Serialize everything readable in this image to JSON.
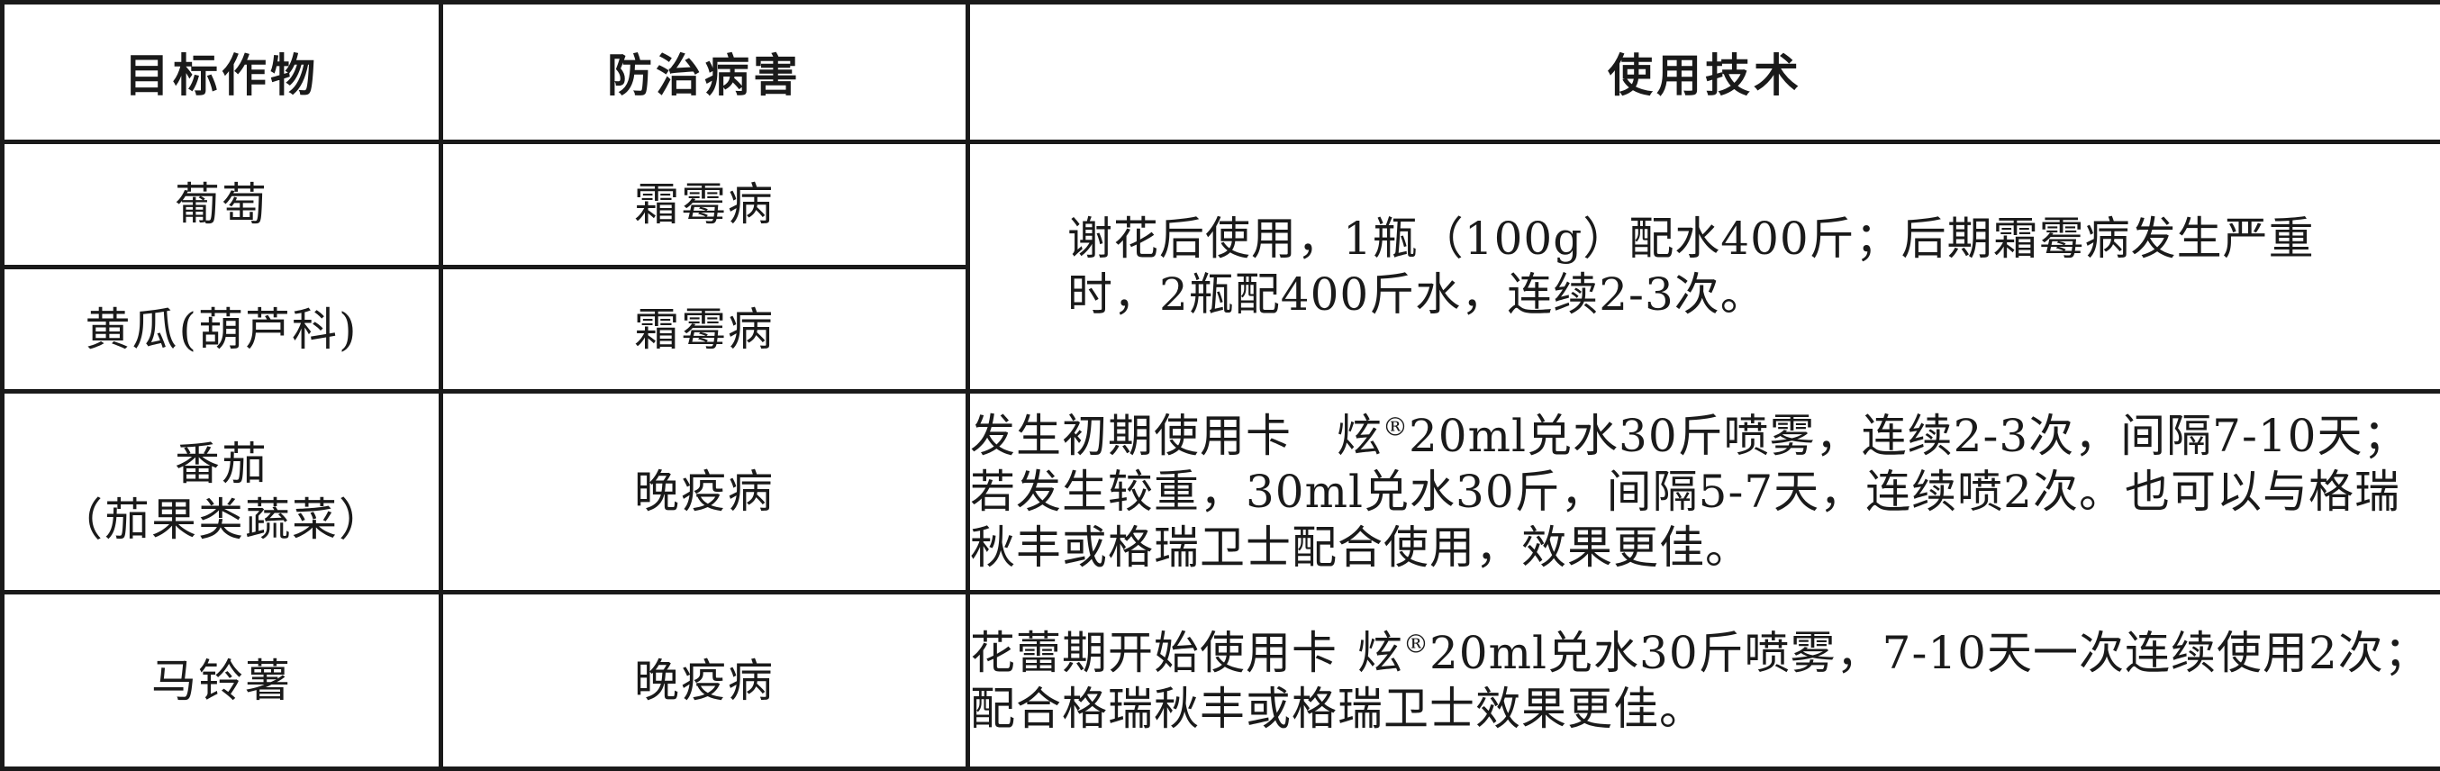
{
  "table": {
    "headers": [
      "目标作物",
      "防治病害",
      "使用技术"
    ],
    "rows": [
      {
        "crop": "葡萄",
        "disease": "霜霉病",
        "tech": "谢花后使用，1瓶（100g）配水400斤；后期霜霉病发生严重时，2瓶配400斤水，连续2-3次。"
      },
      {
        "crop": "黄瓜(葫芦科)",
        "disease": "霜霉病"
      },
      {
        "crop_line1": "番茄",
        "crop_line2": "（茄果类蔬菜）",
        "disease": "晚疫病",
        "tech_part1": "发生初期使用卡",
        "tech_mark": "炫",
        "tech_reg": "®",
        "tech_part2": "20ml兑水30斤喷雾，连续2-3次，间隔7-10天；若发生较重，30ml兑水30斤，间隔5-7天，连续喷2次。也可以与格瑞秋丰或格瑞卫士配合使用，效果更佳。"
      },
      {
        "crop": "马铃薯",
        "disease": "晚疫病",
        "tech_part1": "花蕾期开始使用卡",
        "tech_mark": "炫",
        "tech_reg": "®",
        "tech_part2": "20ml兑水30斤喷雾，7-10天一次连续使用2次；配合格瑞秋丰或格瑞卫士效果更佳。"
      }
    ]
  },
  "colors": {
    "border": "#1a1a1a",
    "text": "#1a1a1a",
    "background": "#ffffff"
  }
}
